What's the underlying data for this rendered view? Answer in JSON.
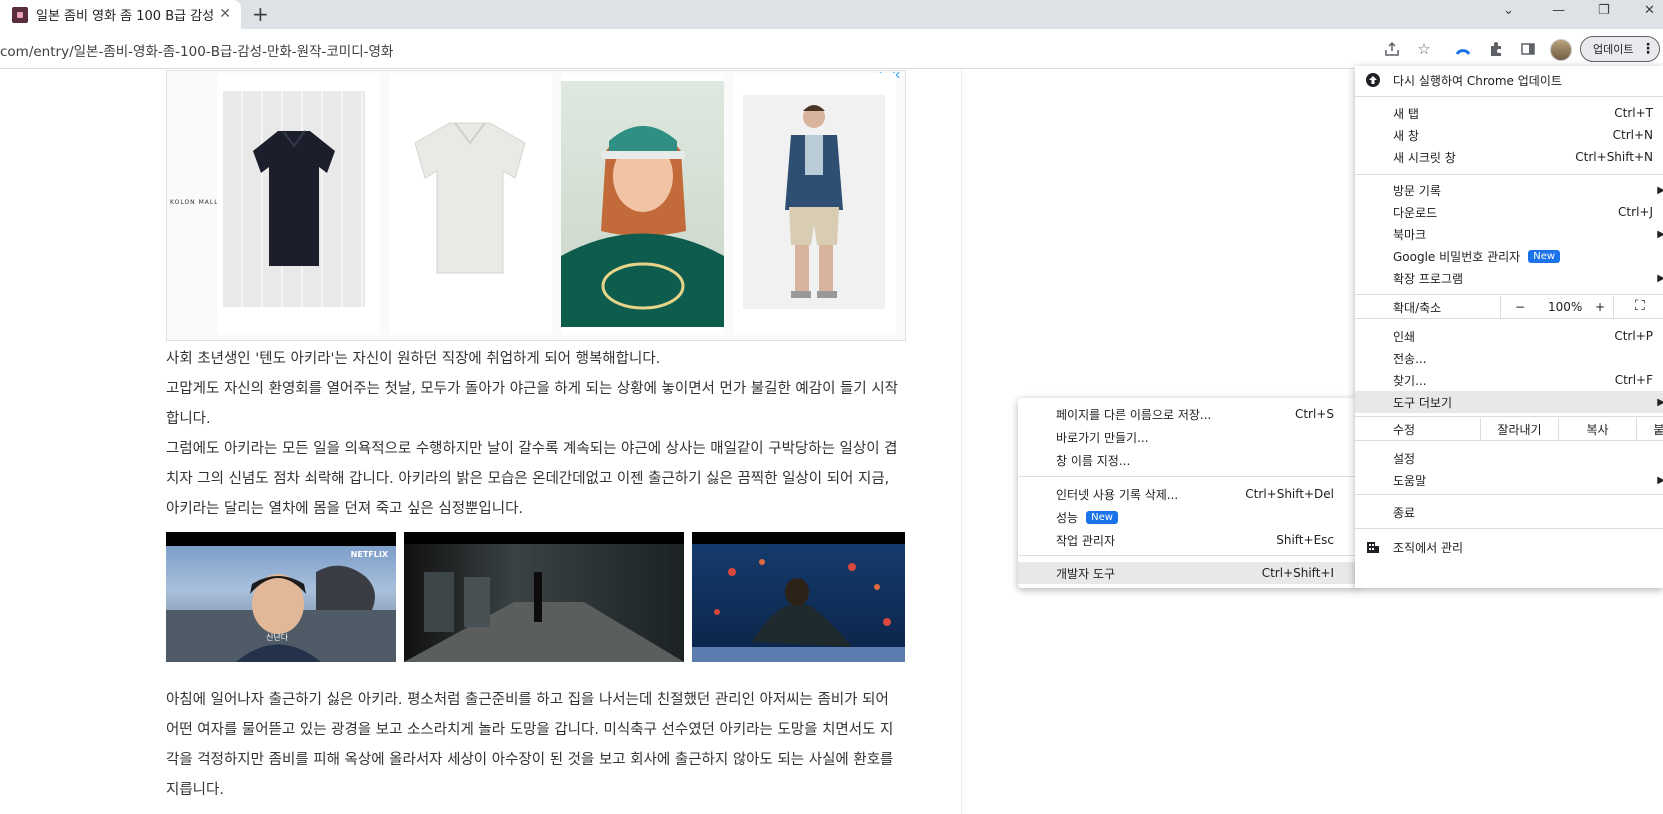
{
  "tab": {
    "title": "일본 좀비 영화 좀 100 B급 감성"
  },
  "toolbar": {
    "url": "com/entry/일본-좀비-영화-좀-100-B급-감성-만화-원작-코미디-영화",
    "update_label": "업데이트"
  },
  "ad": {
    "brand": "KOLON MALL"
  },
  "article": {
    "lines": [
      "사회 초년생인 '텐도 아키라'는 자신이 원하던 직장에 취업하게 되어 행복해합니다.",
      "고맙게도 자신의 환영회를 열어주는 첫날, 모두가 돌아가 야근을 하게 되는 상황에 놓이면서 먼가 불길한 예감이 들기 시작",
      "합니다.",
      "그럼에도 아키라는 모든 일을 의욕적으로 수행하지만 날이 갈수록 계속되는 야근에 상사는 매일같이 구박당하는 일상이 겹",
      "치자 그의 신념도 점차 쇠락해 갑니다. 아키라의 밝은 모습은 온데간데없고 이젠 출근하기 싫은 끔찍한 일상이 되어 지금,",
      "아키라는 달리는 열차에 몸을 던져 죽고 싶은 심정뿐입니다.",
      "아침에 일어나자 출근하기 싫은 아키라. 평소처럼 출근준비를 하고 집을 나서는데 친절했던 관리인 아저씨는 좀비가 되어",
      "어떤 여자를 물어뜯고 있는 광경을 보고 소스라치게 놀라 도망을 갑니다. 미식축구 선수였던 아키라는 도망을 치면서도 지",
      "각을 걱정하지만 좀비를 피해 옥상에 올라서자 세상이 아수장이 된 것을 보고 회사에 출근하지 않아도 되는 사실에 환호를",
      "지릅니다."
    ],
    "frame1": {
      "watermark": "NETFLIX",
      "subtitle": "신난다"
    }
  },
  "tools_menu": {
    "items": [
      {
        "label": "페이지를 다른 이름으로 저장...",
        "shortcut": "Ctrl+S"
      },
      {
        "label": "바로가기 만들기...",
        "shortcut": ""
      },
      {
        "label": "창 이름 지정...",
        "shortcut": ""
      },
      {
        "label": "인터넷 사용 기록 삭제...",
        "shortcut": "Ctrl+Shift+Del"
      },
      {
        "label": "성능",
        "shortcut": "",
        "badge": "New"
      },
      {
        "label": "작업 관리자",
        "shortcut": "Shift+Esc"
      },
      {
        "label": "개발자 도구",
        "shortcut": "Ctrl+Shift+I"
      }
    ]
  },
  "chrome_menu": {
    "relaunch": "다시 실행하여 Chrome 업데이트",
    "new_tab": "새 탭",
    "new_tab_sc": "Ctrl+T",
    "new_window": "새 창",
    "new_window_sc": "Ctrl+N",
    "incognito": "새 시크릿 창",
    "incognito_sc": "Ctrl+Shift+N",
    "history": "방문 기록",
    "downloads": "다운로드",
    "downloads_sc": "Ctrl+J",
    "bookmarks": "북마크",
    "passwords": "Google 비밀번호 관리자",
    "passwords_badge": "New",
    "extensions": "확장 프로그램",
    "zoom_label": "확대/축소",
    "zoom_minus": "−",
    "zoom_value": "100%",
    "zoom_plus": "+",
    "print": "인쇄",
    "print_sc": "Ctrl+P",
    "cast": "전송...",
    "find": "찾기...",
    "find_sc": "Ctrl+F",
    "more_tools": "도구 더보기",
    "edit": "수정",
    "cut": "잘라내기",
    "copy": "복사",
    "paste": "붙여넣기",
    "settings": "설정",
    "help": "도움말",
    "exit": "종료",
    "managed": "조직에서 관리"
  },
  "colors": {
    "accent": "#1a73e8",
    "menu_highlight": "#e8e8e9",
    "tab_bg": "#dee1e6"
  }
}
